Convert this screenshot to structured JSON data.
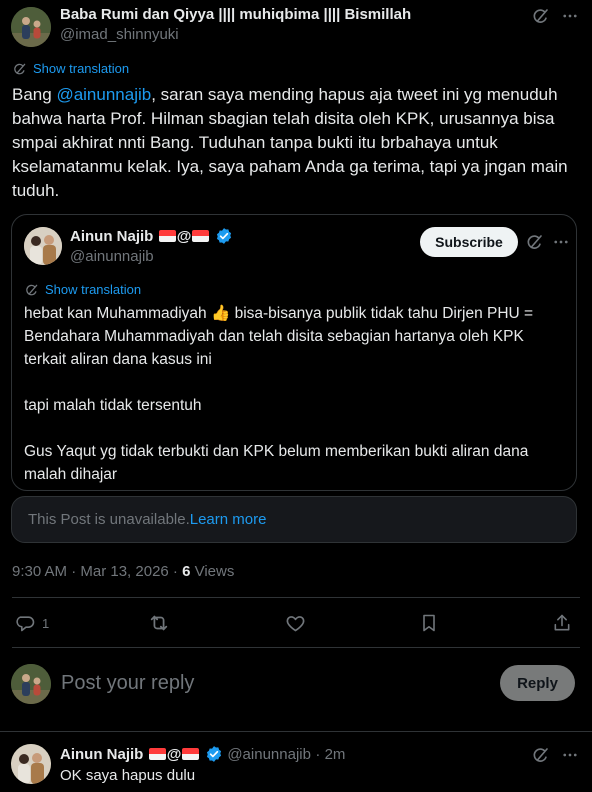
{
  "main_tweet": {
    "author_name": "Baba Rumi dan Qiyya |||| muhiqbima |||| Bismillah",
    "author_handle": "@imad_shinnyuki",
    "show_translation": "Show translation",
    "text_pre": "Bang ",
    "mention": "@ainunnajib",
    "text_post": ", saran saya mending hapus aja tweet ini yg menuduh bahwa harta Prof. Hilman sbagian telah disita oleh KPK, urusannya bisa smpai akhirat nnti Bang. Tuduhan tanpa bukti itu brbahaya untuk kselamatanmu kelak. Iya, saya paham Anda ga terima, tapi ya jngan main tuduh.",
    "timestamp": "9:30 AM · Mar 13, 2026 · ",
    "views_count": "6",
    "views_label": " Views",
    "reply_count": "1"
  },
  "quoted_tweet": {
    "author_name": "Ainun Najib",
    "at_sign": "@",
    "author_handle": "@ainunnajib",
    "subscribe_label": "Subscribe",
    "show_translation": "Show translation",
    "para1_pre": "hebat kan Muhammadiyah ",
    "para1_emoji": "👍",
    "para1_post": " bisa-bisanya publik tidak tahu Dirjen PHU = Bendahara Muhammadiyah dan telah disita sebagian hartanya oleh KPK terkait aliran dana kasus ini",
    "para2": "tapi malah tidak tersentuh",
    "para3": "Gus Yaqut yg tidak terbukti dan KPK belum memberikan bukti aliran dana malah dihajar"
  },
  "unavailable": {
    "text": "This Post is unavailable. ",
    "learn_more": "Learn more"
  },
  "reply_composer": {
    "placeholder": "Post your reply",
    "button_label": "Reply"
  },
  "reply_tweet": {
    "author_name": "Ainun Najib",
    "at_sign": "@",
    "author_handle": "@ainunnajib",
    "time": "· 2m",
    "text": "OK saya hapus dulu"
  },
  "colors": {
    "background": "#000000",
    "text": "#e7e9ea",
    "muted": "#71767b",
    "accent": "#1d9bf0",
    "border": "#2f3336"
  }
}
